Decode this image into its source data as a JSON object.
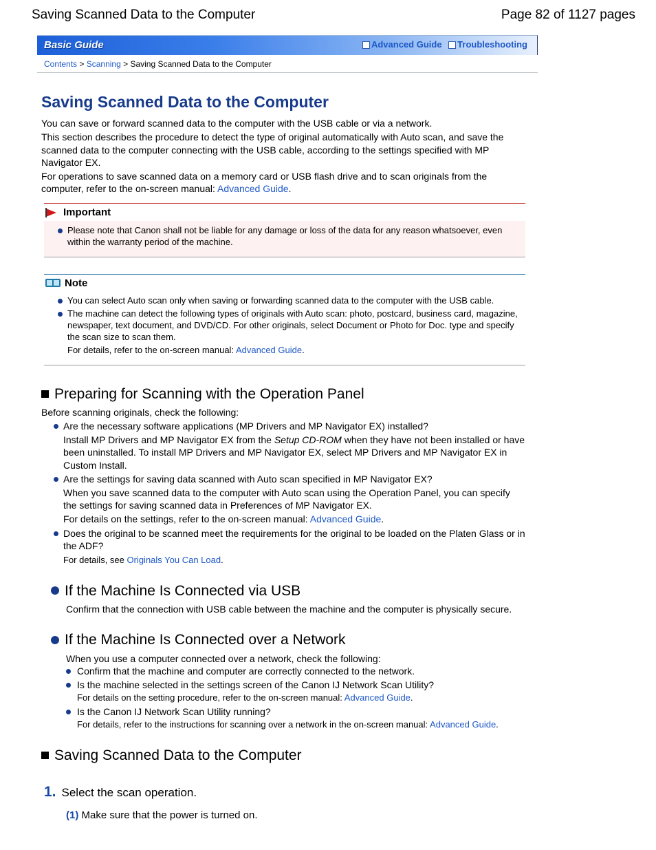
{
  "header": {
    "doc_title": "Saving Scanned Data to the Computer",
    "page_indicator": "Page 82 of 1127 pages"
  },
  "guide_bar": {
    "title": "Basic Guide",
    "advanced": "Advanced Guide",
    "trouble": "Troubleshooting"
  },
  "breadcrumb": {
    "contents": "Contents",
    "scanning": "Scanning",
    "current": "Saving Scanned Data to the Computer"
  },
  "main": {
    "title": "Saving Scanned Data to the Computer",
    "p1": "You can save or forward scanned data to the computer with the USB cable or via a network.",
    "p2": "This section describes the procedure to detect the type of original automatically with Auto scan, and save the scanned data to the computer connecting with the USB cable, according to the settings specified with MP Navigator EX.",
    "p3a": "For operations to save scanned data on a memory card or USB flash drive and to scan originals from the computer, refer to the on-screen manual: ",
    "advanced_guide": "Advanced Guide",
    "important_label": "Important",
    "important_text": "Please note that Canon shall not be liable for any damage or loss of the data for any reason whatsoever, even within the warranty period of the machine.",
    "note_label": "Note",
    "note_b1": "You can select Auto scan only when saving or forwarding scanned data to the computer with the USB cable.",
    "note_b2": "The machine can detect the following types of originals with Auto scan: photo, postcard, business card, magazine, newspaper, text document, and DVD/CD. For other originals, select Document or Photo for Doc. type and specify the scan size to scan them.",
    "note_b2_tail": "For details, refer to the on-screen manual: "
  },
  "prep": {
    "heading": "Preparing for Scanning with the Operation Panel",
    "intro": "Before scanning originals, check the following:",
    "b1": "Are the necessary software applications (MP Drivers and MP Navigator EX) installed?",
    "b1_sub_a": "Install MP Drivers and MP Navigator EX from the ",
    "b1_sub_cd": "Setup CD-ROM",
    "b1_sub_b": " when they have not been installed or have been uninstalled. To install MP Drivers and MP Navigator EX, select MP Drivers and MP Navigator EX in Custom Install.",
    "b2": "Are the settings for saving data scanned with Auto scan specified in MP Navigator EX?",
    "b2_sub": "When you save scanned data to the computer with Auto scan using the Operation Panel, you can specify the settings for saving scanned data in Preferences of MP Navigator EX.",
    "b2_tail": "For details on the settings, refer to the on-screen manual: ",
    "b3": "Does the original to be scanned meet the requirements for the original to be loaded on the Platen Glass or in the ADF?",
    "b3_tail": "For details, see ",
    "originals_link": "Originals You Can Load"
  },
  "usb": {
    "heading": "If the Machine Is Connected via USB",
    "body": "Confirm that the connection with USB cable between the machine and the computer is physically secure."
  },
  "net": {
    "heading": "If the Machine Is Connected over a Network",
    "intro": "When you use a computer connected over a network, check the following:",
    "b1": "Confirm that the machine and computer are correctly connected to the network.",
    "b2": "Is the machine selected in the settings screen of the Canon IJ Network Scan Utility?",
    "b2_tail": "For details on the setting procedure, refer to the on-screen manual: ",
    "b3": "Is the Canon IJ Network Scan Utility running?",
    "b3_tail": "For details, refer to the instructions for scanning over a network in the on-screen manual: "
  },
  "save": {
    "heading": "Saving Scanned Data to the Computer",
    "step1_num": "1.",
    "step1_text": "Select the scan operation.",
    "sub1_num": "(1)",
    "sub1_text": " Make sure that the power is turned on."
  }
}
